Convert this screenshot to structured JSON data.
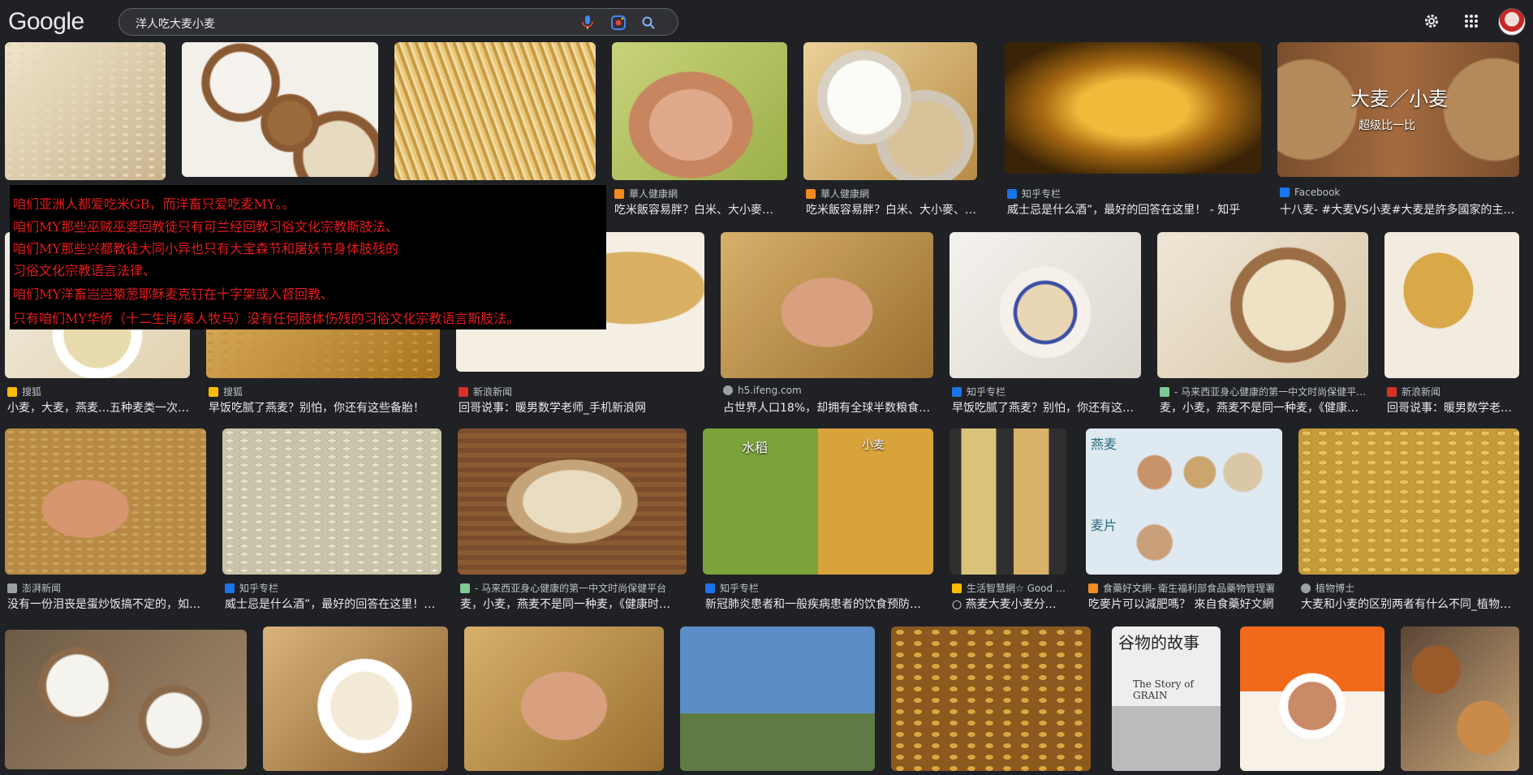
{
  "header": {
    "logo": "Google",
    "search_query": "洋人吃大麦小麦"
  },
  "icons": {
    "mic": "mic-icon",
    "lens": "camera-lens-icon",
    "search": "search-icon",
    "settings": "gear-icon",
    "apps": "apps-grid-icon"
  },
  "overlay_lines": [
    "咱们亚洲人都爱吃米GB，而洋畜只爱吃麦MY。。",
    "咱们MY那些巫贼巫婆回教徒只有可兰经回教习俗文化宗教斯肢法、",
    "咱们MY那些兴都教徒大同小异也只有大宝森节和屠妖节身体肢残的",
    "习俗文化宗教语言法律、",
    "咱们MY洋畜岂岂猿葱耶稣麦克钉在十字架或入督回教、",
    "只有咱们MY华侨（十二生肖/秦人牧马）没有任何肢体伤残的习俗文化宗教语言斯肢法。"
  ],
  "row1": [
    {
      "source": "",
      "caption": ""
    },
    {
      "source": "",
      "caption": ""
    },
    {
      "source": "",
      "caption": ""
    },
    {
      "source": "華人健康網",
      "caption": "吃米飯容易胖？白米、大小麥…"
    },
    {
      "source": "華人健康網",
      "caption": "吃米飯容易胖？白米、大小麥、…"
    },
    {
      "source": "知乎专栏",
      "caption": "威士忌是什么酒”，最好的回答在这里！ - 知乎"
    },
    {
      "source": "Facebook",
      "caption": "十八麦- #大麦VS小麦#大麦是許多國家的主…"
    }
  ],
  "row1_banner_text": "大麦／小麦",
  "row1_banner_sub": "超级比一比",
  "row2": [
    {
      "source": "搜狐",
      "caption": "小麦，大麦，燕麦…五种麦类一次…"
    },
    {
      "source": "搜狐",
      "caption": "早饭吃腻了燕麦？别怕，你还有这些备胎！"
    },
    {
      "source": "新浪新闻",
      "caption": "回哥说事：暖男数学老师_手机新浪网"
    },
    {
      "source": "h5.ifeng.com",
      "caption": "占世界人口18%，却拥有全球半数粮食…"
    },
    {
      "source": "知乎专栏",
      "caption": "早饭吃腻了燕麦？别怕，你还有这…"
    },
    {
      "source": "- 马来西亚身心健康的第一中文时尚保健平…",
      "caption": "麦，小麦，燕麦不是同一种麦，《健康…"
    },
    {
      "source": "新浪新闻",
      "caption": "回哥说事：暖男数学老…"
    }
  ],
  "row3": [
    {
      "source": "澎湃新闻",
      "caption": "没有一份泪丧是蛋炒饭搞不定的，如…"
    },
    {
      "source": "知乎专栏",
      "caption": "威士忌是什么酒”，最好的回答在这里！…"
    },
    {
      "source": "- 马来西亚身心健康的第一中文时尚保健平台",
      "caption": "麦，小麦，燕麦不是同一种麦，《健康时…"
    },
    {
      "source": "知乎专栏",
      "caption": "新冠肺炎患者和一般疾病患者的饮食预防…"
    },
    {
      "source": "生活智慧網☆ Good …",
      "caption": "○ 燕麦大麦小麦分不…"
    },
    {
      "source": "食藥好文網- 衛生福利部食品藥物管理署",
      "caption": "吃麥片可以減肥嗎？ 來自食藥好文網"
    },
    {
      "source": "植物博士",
      "caption": "大麦和小麦的区别两者有什么不同_植物…"
    }
  ],
  "row3_img_labels": {
    "rice": "水稻",
    "wheat": "小麦",
    "oat": "燕麦",
    "flakes": "麦片"
  },
  "row4_book_title": "谷物的故事",
  "row4_book_sub": "The Story of GRAIN"
}
